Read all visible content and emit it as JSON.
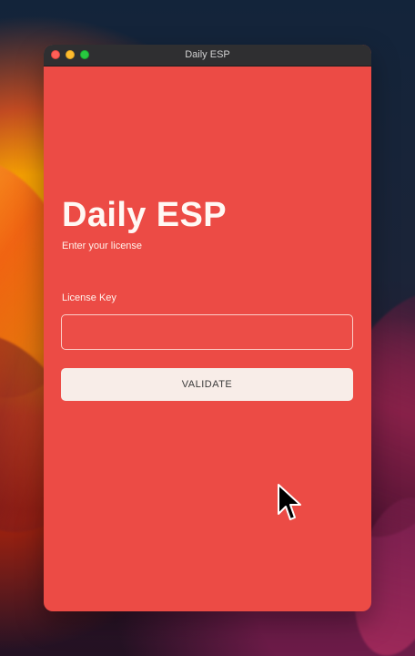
{
  "window": {
    "title": "Daily ESP"
  },
  "app": {
    "title": "Daily ESP",
    "subtitle": "Enter your license",
    "license_label": "License Key",
    "license_value": "",
    "license_placeholder": "",
    "validate_label": "VALIDATE"
  },
  "icons": {
    "close": "close-window-icon",
    "minimize": "minimize-window-icon",
    "zoom": "zoom-window-icon",
    "cursor": "mouse-pointer-icon"
  },
  "colors": {
    "accent": "#ec4b45",
    "button": "#f8ede8",
    "titlebar": "#2f2f31"
  }
}
